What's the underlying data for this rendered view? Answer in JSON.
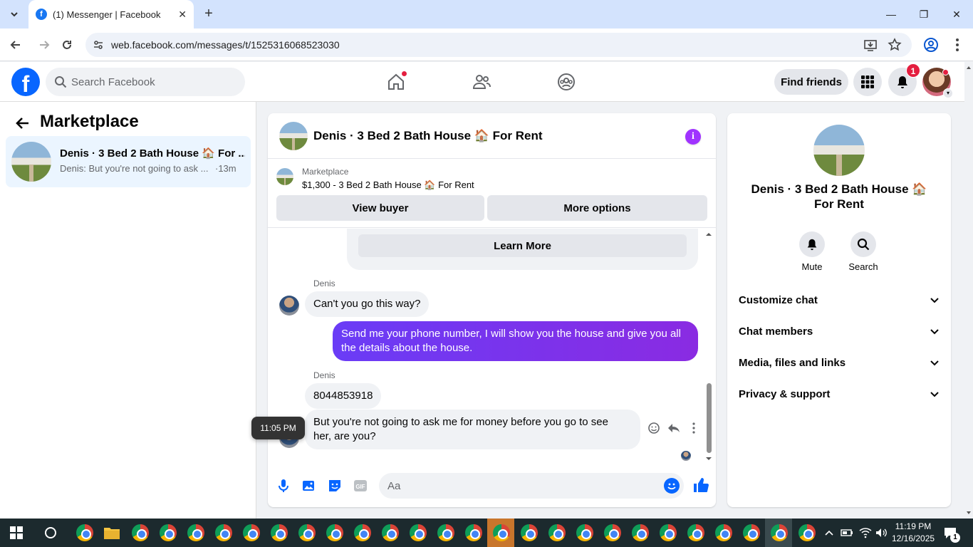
{
  "browser": {
    "tab_title": "(1) Messenger | Facebook",
    "url": "web.facebook.com/messages/t/1525316068523030"
  },
  "fb": {
    "search_placeholder": "Search Facebook",
    "find_friends": "Find friends",
    "notification_count": "1"
  },
  "sidebar": {
    "title": "Marketplace",
    "conversation": {
      "name": "Denis · 3 Bed 2 Bath House 🏠 For ...",
      "preview": "Denis: But you're not going to ask ...",
      "time": "·13m"
    }
  },
  "chat": {
    "title": "Denis · 3 Bed 2 Bath House 🏠 For Rent",
    "listing_label": "Marketplace",
    "listing_price": "$1,300 - 3 Bed 2 Bath House 🏠 For Rent",
    "view_buyer": "View buyer",
    "more_options": "More options",
    "learn_more": "Learn More",
    "messages": [
      {
        "sender": "Denis",
        "text": "Can't you go this way?",
        "direction": "in"
      },
      {
        "text": "Send me your phone number, I will show you the house and give you all the details about the house.",
        "direction": "out"
      },
      {
        "sender": "Denis",
        "text": "8044853918",
        "direction": "in"
      },
      {
        "text": "But you're not going to ask me for money before you go to see her, are you?",
        "direction": "in"
      }
    ],
    "tooltip_time": "11:05 PM",
    "input_placeholder": "Aa"
  },
  "info_panel": {
    "name": "Denis · 3 Bed 2 Bath House 🏠 For Rent",
    "mute": "Mute",
    "search": "Search",
    "sections": [
      "Customize chat",
      "Chat members",
      "Media, files and links",
      "Privacy & support"
    ]
  },
  "taskbar": {
    "time": "11:19 PM",
    "date": "12/16/2025",
    "notif_count": "1"
  },
  "colors": {
    "fb_blue": "#0866ff",
    "outgoing_bubble": "#7b2cf2",
    "badge_red": "#e41e3f"
  }
}
